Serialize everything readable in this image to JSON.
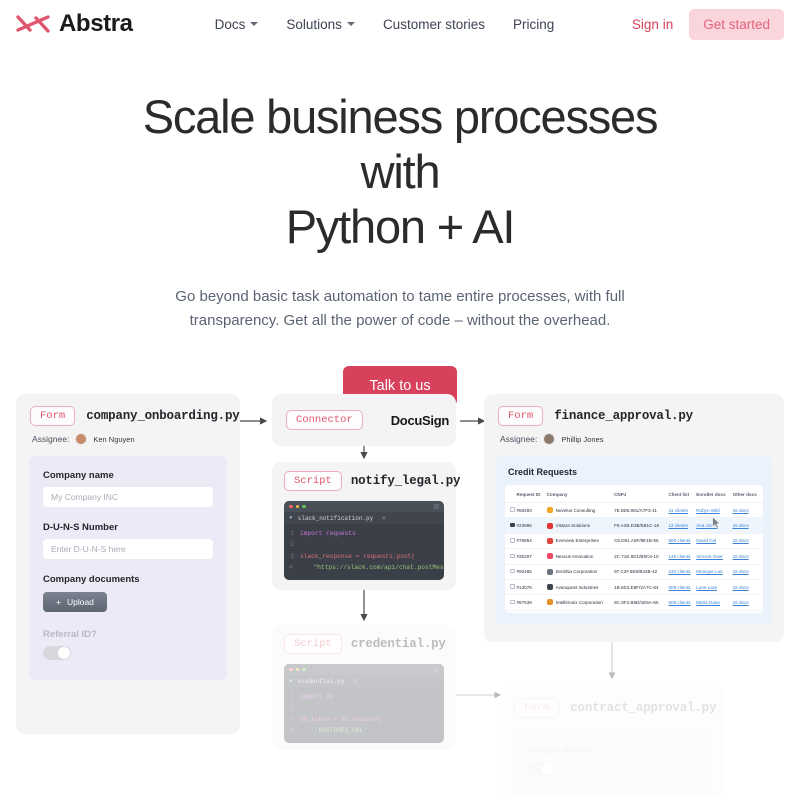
{
  "nav": {
    "brand": "Abstra",
    "logo_icon": "abstra-x-logo",
    "links": [
      {
        "label": "Docs",
        "has_caret": true
      },
      {
        "label": "Solutions",
        "has_caret": true
      },
      {
        "label": "Customer stories",
        "has_caret": false
      },
      {
        "label": "Pricing",
        "has_caret": false
      }
    ],
    "signin": "Sign in",
    "get_started": "Get started",
    "accent": "#d8415c",
    "get_started_bg": "#fbd5dc"
  },
  "hero": {
    "title_line1": "Scale business processes with",
    "title_line2": "Python + AI",
    "subtitle": "Go beyond basic task automation to tame entire processes, with full transparency. Get all the power of code – without the overhead.",
    "cta": "Talk to us"
  },
  "diagram": {
    "onboarding": {
      "pill": "Form",
      "filename": "company_onboarding.py",
      "assignee_label": "Assignee:",
      "assignee_name": "Ken Nguyen",
      "fields": {
        "company_name_label": "Company name",
        "company_name_placeholder": "My Company INC",
        "duns_label": "D-U-N-S Number",
        "duns_placeholder": "Enter D-U-N-S here",
        "documents_label": "Company documents",
        "upload_button": "Upload",
        "referral_label": "Referral ID?"
      }
    },
    "connector": {
      "pill": "Connector",
      "title": "DocuSign"
    },
    "notify": {
      "pill": "Script",
      "filename": "notify_legal.py",
      "icon": "slack-icon",
      "editor_tab": "slack_notification.py",
      "code": [
        {
          "n": "1",
          "text": "import requests"
        },
        {
          "n": "2",
          "text": ""
        },
        {
          "n": "3",
          "text": "slack_response = requests.post("
        },
        {
          "n": "4",
          "text": "    \"https://slack.com/api/chat.postMessage\""
        }
      ]
    },
    "credential": {
      "pill": "Script",
      "filename": "credential.py",
      "icon": "postgresql-icon",
      "editor_tab": "credential.py",
      "code": [
        {
          "n": "1",
          "text": "import os"
        },
        {
          "n": "2",
          "text": ""
        },
        {
          "n": "3",
          "text": "db_token = os.environ("
        },
        {
          "n": "4",
          "text": "    'POSTGRES_URL'"
        }
      ]
    },
    "finance": {
      "pill": "Form",
      "filename": "finance_approval.py",
      "assignee_label": "Assignee:",
      "assignee_name": "Phillip Jones",
      "table_title": "Credit Requests",
      "columns": [
        "Request ID",
        "Company",
        "CNPJ",
        "Client list",
        "Enroller docs",
        "Other docs"
      ],
      "rows": [
        {
          "checked": false,
          "id": "#58493",
          "company": "Novelus Consulting",
          "color": "#f5a623",
          "cnpj": "7E.8D6.981/A7F3-11",
          "clients": "41 clients",
          "enroller": "Robyn Wild",
          "other": "15 docs"
        },
        {
          "checked": true,
          "id": "#23986",
          "company": "Vistara Solutions",
          "color": "#e3342f",
          "cnpj": "F6.A2B.D3B/5B1C-16",
          "clients": "12 clients",
          "enroller": "Ana Jones",
          "other": "15 docs"
        },
        {
          "checked": false,
          "id": "#76854",
          "company": "Everview Enterprises",
          "color": "#e0453c",
          "cnpj": "C6.D91.A6F/9E1B-66",
          "clients": "600 clients",
          "enroller": "David Cel",
          "other": "15 docs"
        },
        {
          "checked": false,
          "id": "#35297",
          "company": "Nexxus Innovation",
          "color": "#f24b6a",
          "cnpj": "2C.71E.8D1/B9C6-10",
          "clients": "145 clients",
          "enroller": "Vincent Geer",
          "other": "15 docs"
        },
        {
          "checked": false,
          "id": "#92465",
          "company": "Zenithia Corporation",
          "color": "#6c7480",
          "cnpj": "97.C2F.8E6/B34B-42",
          "clients": "240 clients",
          "enroller": "Monique Lue",
          "other": "15 docs"
        },
        {
          "checked": false,
          "id": "#13076",
          "company": "Avanquest Industries",
          "color": "#3d4450",
          "cnpj": "1B.6D3.E8F/2A7C-84",
          "clients": "509 clients",
          "enroller": "Lune Lara",
          "other": "15 docs"
        },
        {
          "checked": false,
          "id": "#87539",
          "company": "Intellitronix Corporation",
          "color": "#e8912b",
          "cnpj": "8C.8F2.B9D/1E5A-55",
          "clients": "509 clients",
          "enroller": "Maria Dane",
          "other": "15 docs"
        }
      ]
    },
    "contract": {
      "pill": "Form",
      "filename": "contract_approval.py",
      "toggle_label": "Include token?"
    }
  }
}
